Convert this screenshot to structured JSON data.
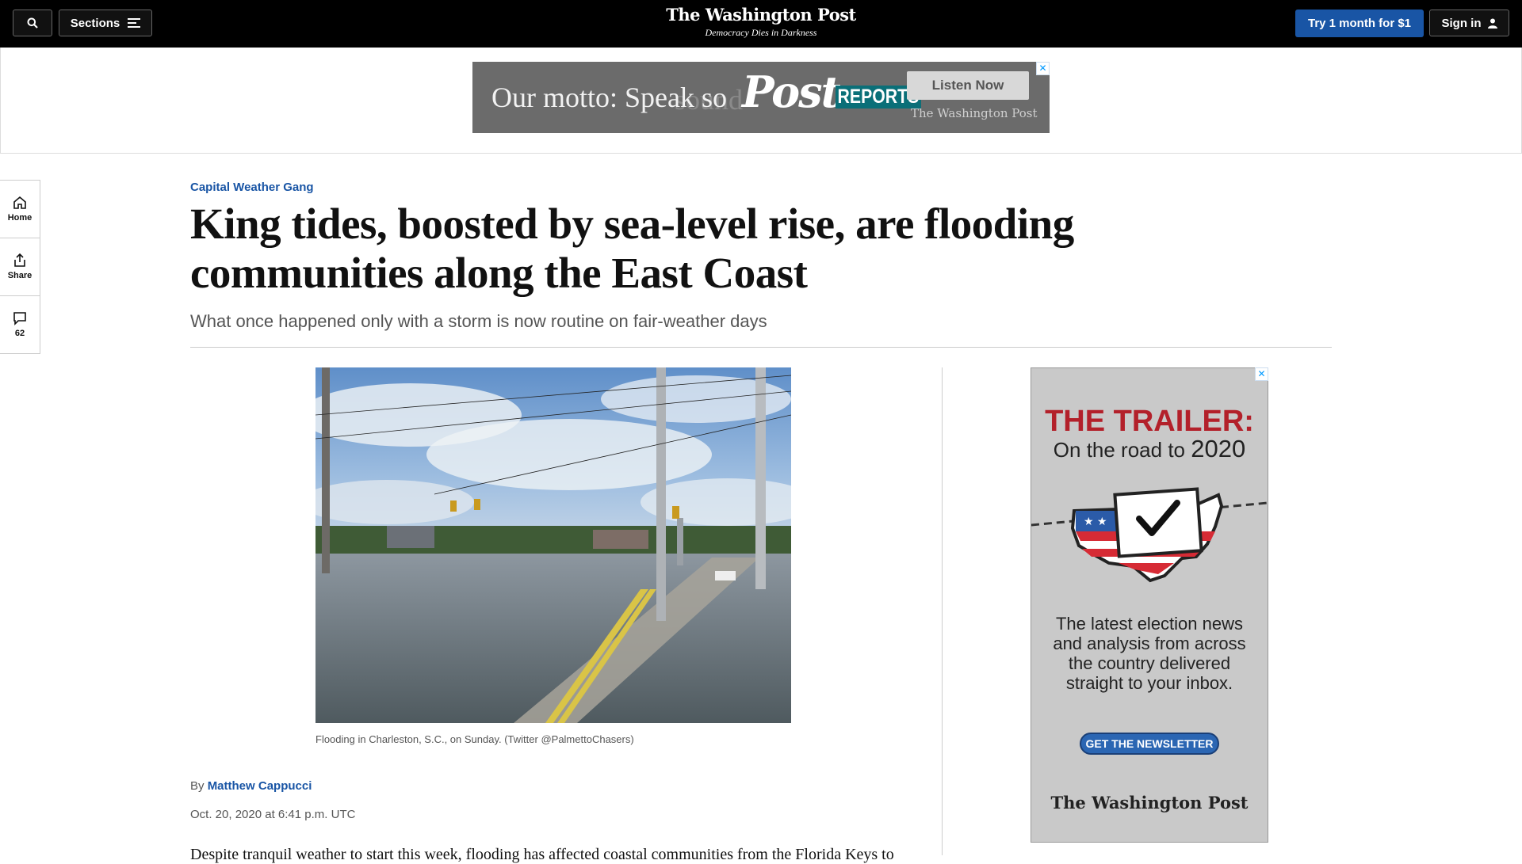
{
  "nav": {
    "sections_label": "Sections",
    "logo": "The Washington Post",
    "tagline": "Democracy Dies in Darkness",
    "trial_label": "Try 1 month for $1",
    "signin_label": "Sign in"
  },
  "top_ad": {
    "motto": "Our motto: Speak so",
    "ghost_text": "sound",
    "post_logo": "Post",
    "reports": "REPORTS",
    "listen_label": "Listen Now",
    "brand": "The Washington Post",
    "close": "✕"
  },
  "rail": {
    "home": "Home",
    "share": "Share",
    "comments": "62"
  },
  "article": {
    "kicker": "Capital Weather Gang",
    "headline": "King tides, boosted by sea-level rise, are flooding communities along the East Coast",
    "dek": "What once happened only with a storm is now routine on fair-weather days",
    "caption": "Flooding in Charleston, S.C., on Sunday. (Twitter @PalmettoChasers)",
    "byline_prefix": "By",
    "author": "Matthew Cappucci",
    "date": "Oct. 20, 2020 at 6:41 p.m. UTC",
    "body_first_line": "Despite tranquil weather to start this week, flooding has affected coastal communities from the Florida Keys to"
  },
  "side_ad": {
    "title": "THE TRAILER:",
    "subtitle": "On the road to",
    "year": "2020",
    "body": "The latest election news and analysis from across the country delivered straight to your inbox.",
    "cta": "GET THE NEWSLETTER",
    "brand": "The Washington Post",
    "close": "✕"
  }
}
